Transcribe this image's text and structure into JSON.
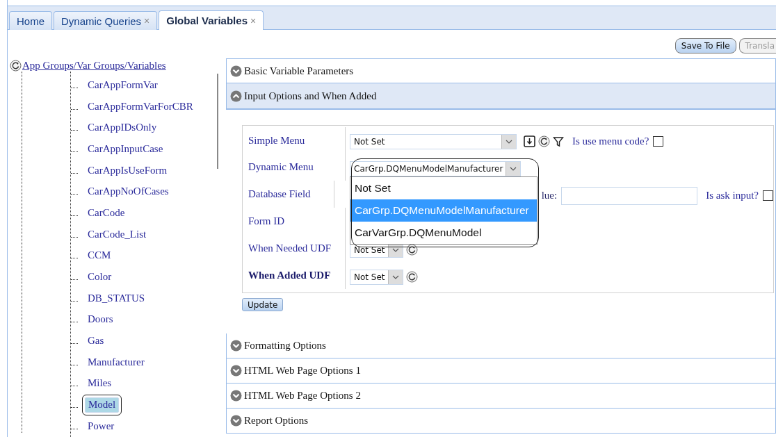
{
  "tabs": [
    {
      "label": "Home",
      "selected": false
    },
    {
      "label": "Dynamic Queries",
      "close": "×",
      "selected": false
    },
    {
      "label": "Global Variables",
      "close": "×",
      "selected": true
    }
  ],
  "toolbar": {
    "buttons": [
      {
        "label": "Save To File",
        "disabled": false
      },
      {
        "label": "Transla",
        "disabled": true
      }
    ]
  },
  "tree": {
    "root": "App Groups/Var Groups/Variables",
    "children": [
      {
        "label": "CarAppFormVar",
        "selected": false
      },
      {
        "label": "CarAppFormVarForCBR",
        "selected": false
      },
      {
        "label": "CarAppIDsOnly",
        "selected": false
      },
      {
        "label": "CarAppInputCase",
        "selected": false
      },
      {
        "label": "CarAppIsUseForm",
        "selected": false
      },
      {
        "label": "CarAppNoOfCases",
        "selected": false
      },
      {
        "label": "CarCode",
        "selected": false
      },
      {
        "label": "CarCode_List",
        "selected": false
      },
      {
        "label": "CCM",
        "selected": false
      },
      {
        "label": "Color",
        "selected": false
      },
      {
        "label": "DB_STATUS",
        "selected": false
      },
      {
        "label": "Doors",
        "selected": false
      },
      {
        "label": "Gas",
        "selected": false
      },
      {
        "label": "Manufacturer",
        "selected": false
      },
      {
        "label": "Miles",
        "selected": false
      },
      {
        "label": "Model",
        "selected": true
      },
      {
        "label": "Power",
        "selected": false
      }
    ]
  },
  "sections": [
    {
      "title": "Basic Variable Parameters",
      "expanded": false
    },
    {
      "title": "Input Options and When Added",
      "expanded": true,
      "form": {
        "rows": [
          {
            "kind": "select-tools",
            "label": "Simple Menu",
            "value": "Not Set",
            "checkbox_label": "Is use menu code?",
            "checked": false
          },
          {
            "kind": "dropdown",
            "label": "Dynamic Menu",
            "value": "CarGrp.DQMenuModelManufacturer",
            "open": true,
            "options": [
              {
                "label": "Not Set",
                "selected": false
              },
              {
                "label": "CarGrp.DQMenuModelManufacturer",
                "selected": true
              },
              {
                "label": "CarVarGrp.DQMenuModel",
                "selected": false
              }
            ]
          },
          {
            "kind": "field",
            "label": "Database Field",
            "field_label": "lue:",
            "checkbox_label": "Is ask input?",
            "checked": false
          },
          {
            "kind": "blank",
            "label": "Form ID"
          },
          {
            "kind": "small-select",
            "label": "When Needed UDF",
            "value": "Not Set",
            "bold": false
          },
          {
            "kind": "small-select",
            "label": "When Added UDF",
            "value": "Not Set",
            "bold": true
          }
        ],
        "update_button": "Update"
      }
    },
    {
      "title": "Formatting Options",
      "expanded": false
    },
    {
      "title": "HTML Web Page Options 1",
      "expanded": false
    },
    {
      "title": "HTML Web Page Options 2",
      "expanded": false
    },
    {
      "title": "Report Options",
      "expanded": false
    }
  ]
}
